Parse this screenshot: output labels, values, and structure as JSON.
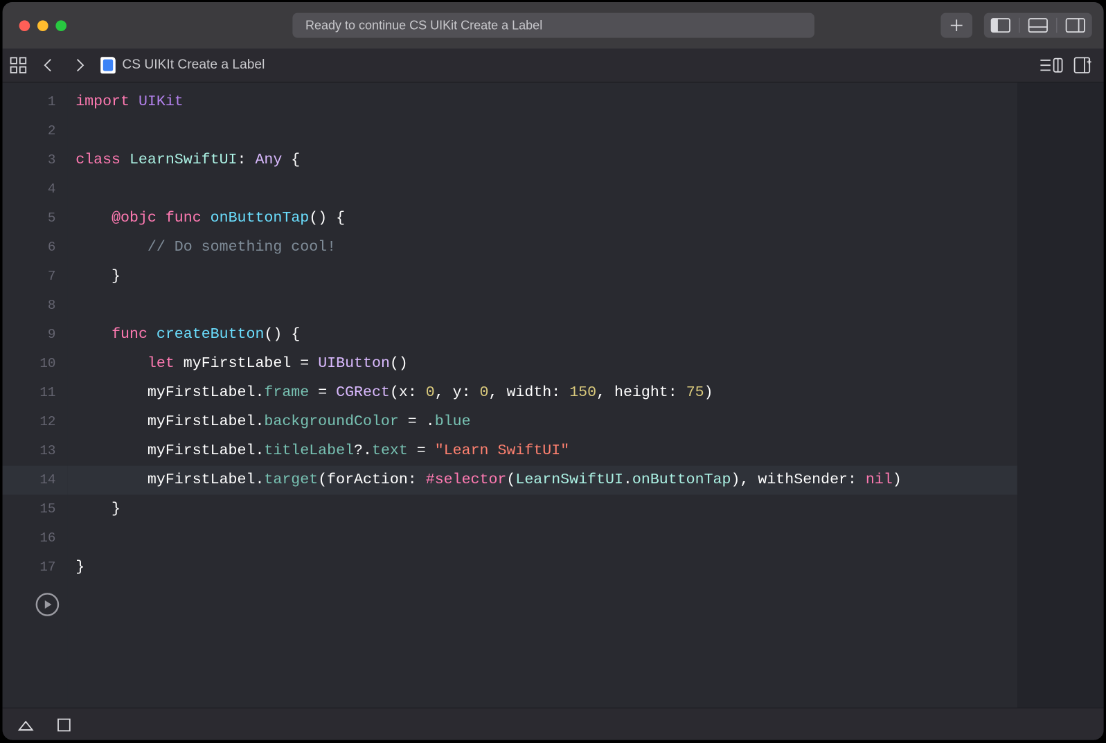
{
  "toolbar": {
    "title": "Ready to continue CS UIKit Create a Label"
  },
  "tabbar": {
    "file_name": "CS UIKIt Create a Label"
  },
  "editor": {
    "highlighted_line": 14,
    "run_button_at_line": 17,
    "lines": [
      [
        {
          "t": "import ",
          "c": "kw"
        },
        {
          "t": "UIKit",
          "c": "lib"
        }
      ],
      [],
      [
        {
          "t": "class ",
          "c": "kw"
        },
        {
          "t": "LearnSwiftUI",
          "c": "at"
        },
        {
          "t": ": ",
          "c": "pl"
        },
        {
          "t": "Any",
          "c": "dtp"
        },
        {
          "t": " {",
          "c": "pl"
        }
      ],
      [],
      [
        {
          "t": "    ",
          "c": "pl"
        },
        {
          "t": "@objc ",
          "c": "kw"
        },
        {
          "t": "func ",
          "c": "kw"
        },
        {
          "t": "onButtonTap",
          "c": "tp"
        },
        {
          "t": "() {",
          "c": "pl"
        }
      ],
      [
        {
          "t": "        ",
          "c": "pl"
        },
        {
          "t": "// Do something cool!",
          "c": "cm"
        }
      ],
      [
        {
          "t": "    }",
          "c": "pl"
        }
      ],
      [],
      [
        {
          "t": "    ",
          "c": "pl"
        },
        {
          "t": "func ",
          "c": "kw"
        },
        {
          "t": "createButton",
          "c": "tp"
        },
        {
          "t": "() {",
          "c": "pl"
        }
      ],
      [
        {
          "t": "        ",
          "c": "pl"
        },
        {
          "t": "let ",
          "c": "kw"
        },
        {
          "t": "myFirstLabel = ",
          "c": "pl"
        },
        {
          "t": "UIButton",
          "c": "dtp"
        },
        {
          "t": "()",
          "c": "pl"
        }
      ],
      [
        {
          "t": "        myFirstLabel.",
          "c": "pl"
        },
        {
          "t": "frame",
          "c": "prop"
        },
        {
          "t": " = ",
          "c": "pl"
        },
        {
          "t": "CGRect",
          "c": "dtp"
        },
        {
          "t": "(x: ",
          "c": "pl"
        },
        {
          "t": "0",
          "c": "nm"
        },
        {
          "t": ", y: ",
          "c": "pl"
        },
        {
          "t": "0",
          "c": "nm"
        },
        {
          "t": ", width: ",
          "c": "pl"
        },
        {
          "t": "150",
          "c": "nm"
        },
        {
          "t": ", height: ",
          "c": "pl"
        },
        {
          "t": "75",
          "c": "nm"
        },
        {
          "t": ")",
          "c": "pl"
        }
      ],
      [
        {
          "t": "        myFirstLabel.",
          "c": "pl"
        },
        {
          "t": "backgroundColor",
          "c": "prop"
        },
        {
          "t": " = .",
          "c": "pl"
        },
        {
          "t": "blue",
          "c": "prop"
        }
      ],
      [
        {
          "t": "        myFirstLabel.",
          "c": "pl"
        },
        {
          "t": "titleLabel",
          "c": "prop"
        },
        {
          "t": "?.",
          "c": "pl"
        },
        {
          "t": "text",
          "c": "prop"
        },
        {
          "t": " = ",
          "c": "pl"
        },
        {
          "t": "\"Learn SwiftUI\"",
          "c": "st"
        }
      ],
      [
        {
          "t": "        myFirstLabel.",
          "c": "pl"
        },
        {
          "t": "target",
          "c": "prop"
        },
        {
          "t": "(forAction: ",
          "c": "pl"
        },
        {
          "t": "#selector",
          "c": "kw"
        },
        {
          "t": "(",
          "c": "pl"
        },
        {
          "t": "LearnSwiftUI",
          "c": "at"
        },
        {
          "t": ".",
          "c": "pl"
        },
        {
          "t": "onButtonTap",
          "c": "at"
        },
        {
          "t": "), withSender: ",
          "c": "pl"
        },
        {
          "t": "nil",
          "c": "kw"
        },
        {
          "t": ")",
          "c": "pl"
        }
      ],
      [
        {
          "t": "    }",
          "c": "pl"
        }
      ],
      [],
      [
        {
          "t": "}",
          "c": "pl"
        }
      ]
    ]
  }
}
